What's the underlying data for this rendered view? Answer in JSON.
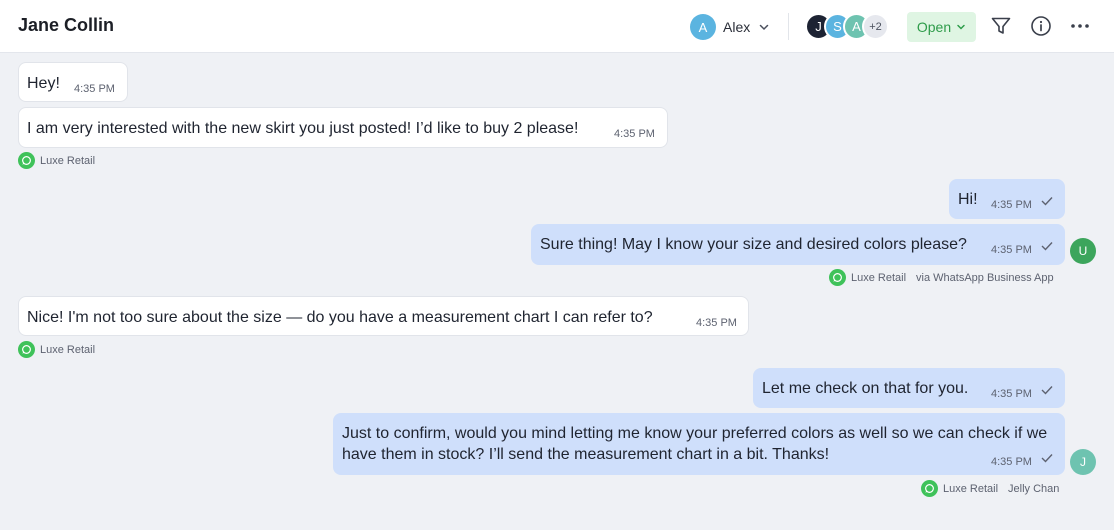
{
  "header": {
    "contact_name": "Jane Collin",
    "assignee": {
      "initial": "A",
      "name": "Alex",
      "color": "#5bb4e0"
    },
    "collaborators": [
      {
        "initial": "J",
        "color": "#1d2333"
      },
      {
        "initial": "S",
        "color": "#5bb4e0"
      },
      {
        "initial": "A",
        "color": "#6ec3b0"
      }
    ],
    "collaborators_more": "+2",
    "status_label": "Open",
    "icons": [
      "filter-icon",
      "info-icon",
      "more-options-icon"
    ]
  },
  "messages": [
    {
      "id": "m1",
      "direction": "in",
      "text": "Hey!",
      "time": "4:35 PM"
    },
    {
      "id": "m2",
      "direction": "in",
      "text": "I am very interested with the new skirt you just posted! I’d like to buy 2 please!",
      "time": "4:35 PM",
      "channel": "Luxe Retail"
    },
    {
      "id": "m3",
      "direction": "out",
      "text": "Hi!",
      "time": "4:35 PM"
    },
    {
      "id": "m4",
      "direction": "out",
      "text": "Sure thing! May I know your size and desired colors please?",
      "time": "4:35 PM",
      "channel": "Luxe Retail",
      "via": "via WhatsApp Business App",
      "agent_initial": "U",
      "agent_color": "#3ca55c"
    },
    {
      "id": "m5",
      "direction": "in",
      "text": "Nice! I'm not too sure about the size — do you have a measurement chart I can refer to?",
      "time": "4:35 PM",
      "channel": "Luxe Retail"
    },
    {
      "id": "m6",
      "direction": "out",
      "text": "Let me check on that for you.",
      "time": "4:35 PM"
    },
    {
      "id": "m7",
      "direction": "out",
      "text": "Just to confirm, would you mind letting me know your preferred colors as well so we can check if we have them in stock? I’ll send the measurement chart in a bit. Thanks!",
      "time": "4:35 PM",
      "channel": "Luxe Retail",
      "via": "Jelly Chan",
      "agent_initial": "J",
      "agent_color": "#6ec3b0"
    }
  ],
  "colors": {
    "incoming_bubble": "#ffffff",
    "outgoing_bubble": "#cfdffb",
    "status_bg": "#dff5e3",
    "status_text": "#2e9c4a",
    "whatsapp": "#3fc25a"
  }
}
